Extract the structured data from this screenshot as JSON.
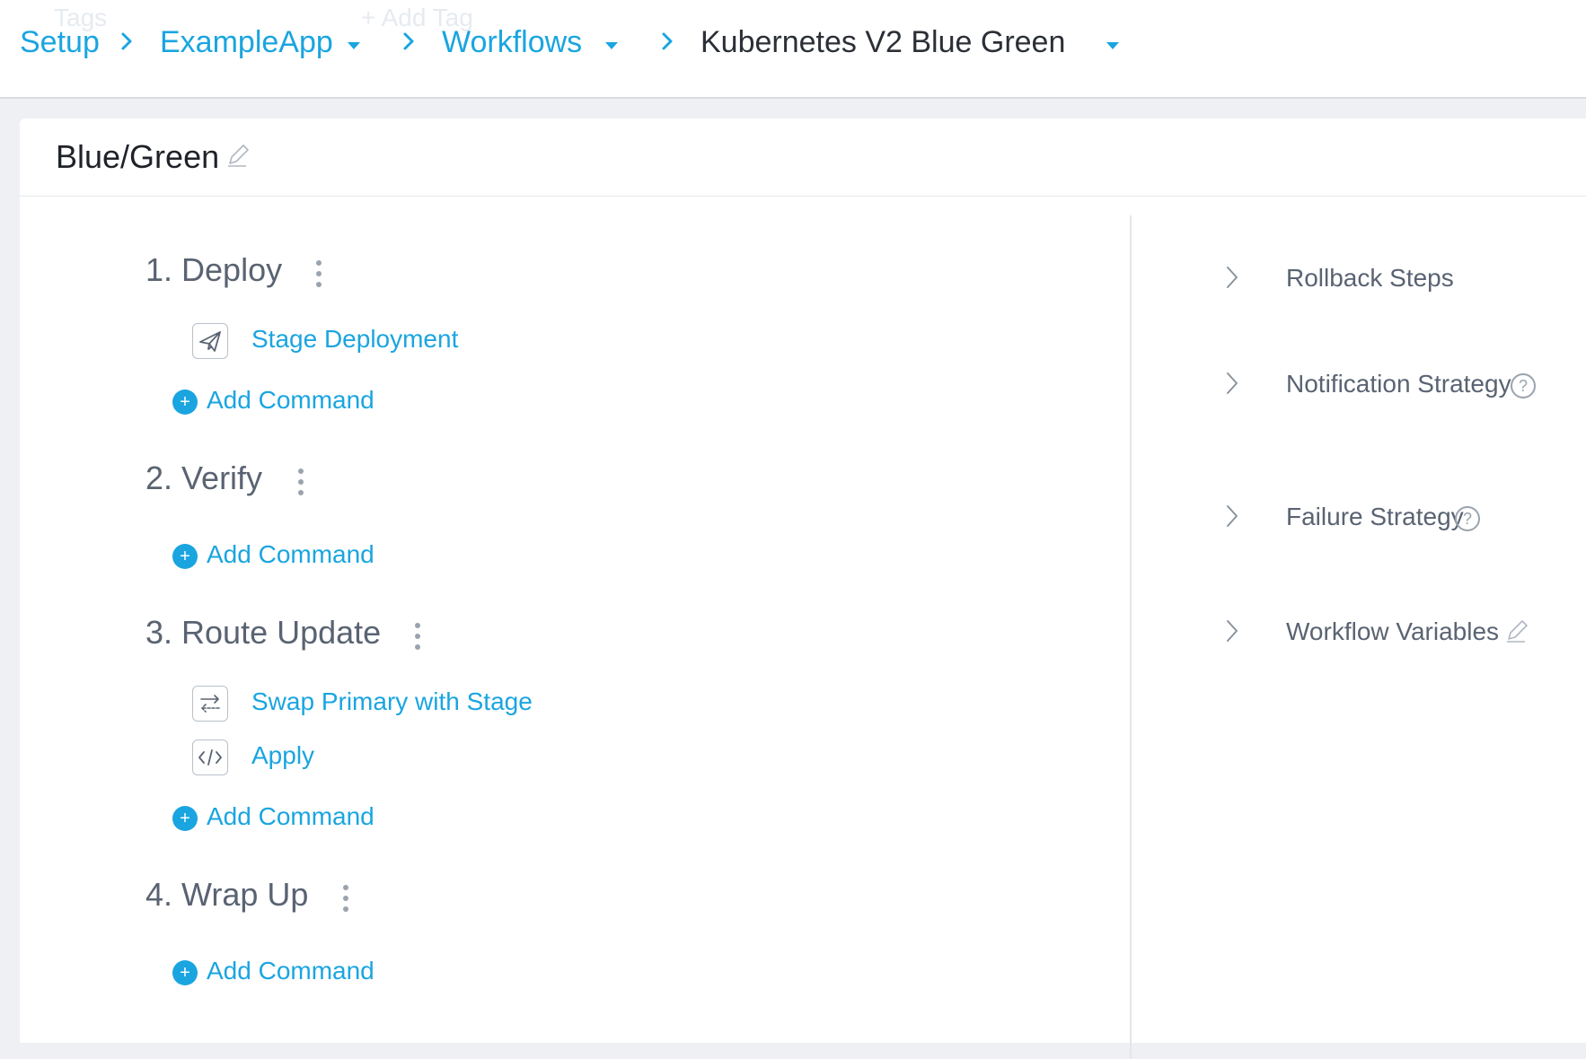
{
  "header": {
    "ghost_tags": "Tags",
    "ghost_add_tag": "+ Add Tag",
    "breadcrumbs": [
      {
        "label": "Setup"
      },
      {
        "label": "ExampleApp"
      },
      {
        "label": "Workflows"
      },
      {
        "label": "Kubernetes V2 Blue Green"
      }
    ]
  },
  "workflow": {
    "title": "Blue/Green"
  },
  "phases": [
    {
      "label": "1. Deploy",
      "steps": [
        {
          "label": "Stage Deployment",
          "icon": "paper-plane-icon"
        }
      ],
      "add_label": "Add Command"
    },
    {
      "label": "2. Verify",
      "steps": [],
      "add_label": "Add Command"
    },
    {
      "label": "3. Route Update",
      "steps": [
        {
          "label": "Swap Primary with Stage",
          "icon": "swap-arrows-icon"
        },
        {
          "label": "Apply",
          "icon": "code-icon"
        }
      ],
      "add_label": "Add Command"
    },
    {
      "label": "4. Wrap Up",
      "steps": [],
      "add_label": "Add Command"
    }
  ],
  "sidebar": {
    "items": [
      {
        "label": "Rollback Steps"
      },
      {
        "label": "Notification Strategy",
        "help": "?"
      },
      {
        "label": "Failure Strategy",
        "help": "?"
      },
      {
        "label": "Workflow Variables"
      }
    ]
  },
  "colors": {
    "accent": "#1aa5e0",
    "text_muted": "#5a6372",
    "text_dark": "#1f2329",
    "background": "#eef0f3"
  }
}
